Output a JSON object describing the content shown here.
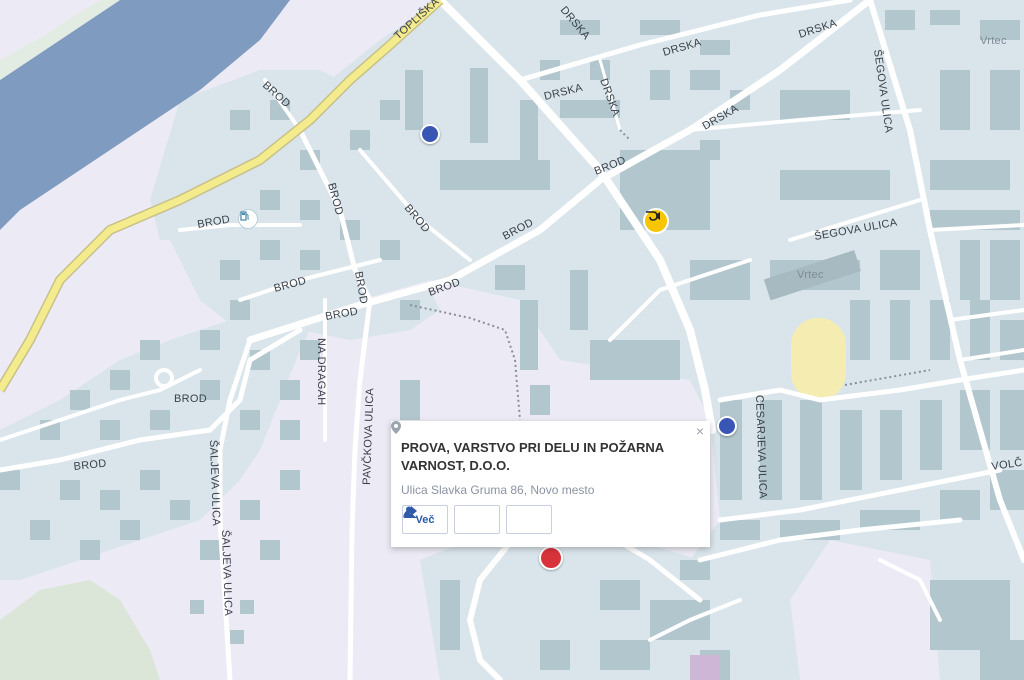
{
  "map": {
    "street_labels": {
      "toplisko": "TOPLIŠKA",
      "drska1": "DRSKA",
      "drska2": "DRSKA",
      "drska3": "DRSKA",
      "drska4": "DRSKA",
      "drska5": "DRSKA",
      "drska6": "DRSKA",
      "segova1": "ŠEGOVA ULICA",
      "segova2": "ŠEGOVA ULICA",
      "vrtec1": "Vrtec",
      "vrtec2": "Vrtec",
      "brod1": "BROD",
      "brod2": "BROD",
      "brod3": "BROD",
      "brod4": "BROD",
      "brod5": "BROD",
      "brod6": "BROD",
      "brod7": "BROD",
      "brod8": "BROD",
      "brod9": "BROD",
      "brod10": "BROD",
      "brod11": "BROD",
      "brod12": "BROD",
      "nadragah": "NA DRAGAH",
      "pavckova": "PAVČKOVA ULICA",
      "saljeva1": "ŠALJEVA ULICA",
      "saljeva2": "ŠALJEVA ULICA",
      "cesarjeva": "CESARJEVA ULICA",
      "volc": "VOLČ"
    },
    "icons": {
      "marker": "location-dot-icon",
      "post": "post-horn-icon",
      "fuel": "fuel-station-icon",
      "pin": "selected-pin-icon"
    },
    "colors": {
      "background": "#eceaf4",
      "water": "#7f9bbf",
      "urban": "#d9e5ea",
      "building": "#b2c6cd",
      "road": "#ffffff",
      "main_road": "#f4ec8c",
      "park": "#dbe6d8",
      "stadium": "#f4ecb0",
      "marker": "#3956b5",
      "post": "#f7c600",
      "pin": "#d8333b"
    }
  },
  "popup": {
    "title": "PROVA, VARSTVO PRI DELU IN POŽARNA VARNOST, D.O.O.",
    "address": "Ulica Slavka Gruma 86, Novo mesto",
    "close": "×",
    "more_label": "Več",
    "buttons": [
      "more-button",
      "contact-button",
      "directions-button"
    ]
  }
}
